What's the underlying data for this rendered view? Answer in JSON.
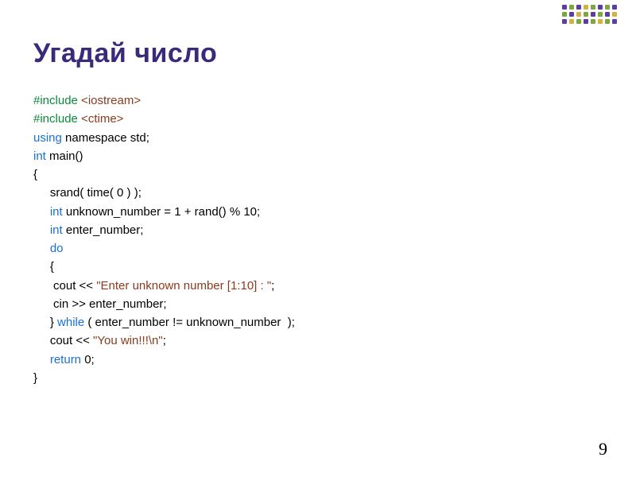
{
  "title": "Угадай число",
  "code": {
    "l1_pre": "#include",
    "l1_hdr": " <iostream>",
    "l2_pre": "#include",
    "l2_hdr": " <ctime>",
    "l3_kw": "using ",
    "l3_rest": "namespace std;",
    "l4_kw": "int ",
    "l4_rest": "main()",
    "l5": "{",
    "l6": "     srand( time( 0 ) );",
    "l7_pad": "     ",
    "l7_kw": "int ",
    "l7_rest": "unknown_number = 1 + rand() % 10;",
    "l8_pad": "     ",
    "l8_kw": "int ",
    "l8_rest": "enter_number;",
    "l9_pad": "     ",
    "l9_kw": "do",
    "l10": "     {",
    "l11_pad": "      cout << ",
    "l11_str": "\"Enter unknown number [1:10] : \"",
    "l11_end": ";",
    "l12": "      cin >> enter_number;",
    "l13_pad": "     } ",
    "l13_kw": "while",
    "l13_rest": " ( enter_number != unknown_number  );",
    "l14_pad": "     cout << ",
    "l14_str": "\"You win!!!\\n\"",
    "l14_end": ";",
    "l15_pad": "     ",
    "l15_kw": "return ",
    "l15_rest": "0;",
    "l16": "}"
  },
  "page_number": "9"
}
